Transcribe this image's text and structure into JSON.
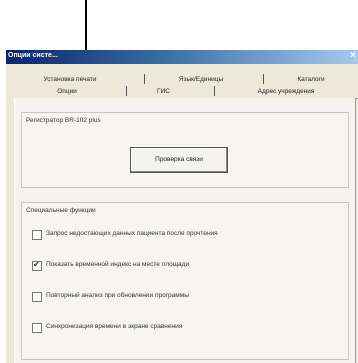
{
  "window": {
    "title": "Опции систе...",
    "close_icon": "close-icon"
  },
  "tabs_back": [
    "Установка печати",
    "Язык/Единицы",
    "Каталоги"
  ],
  "tabs_front": [
    "Опции",
    "ГИС",
    "Адрес учреждения"
  ],
  "registrator": {
    "label": "Регистратор BR-102 plus",
    "test_button": "Проверка связи"
  },
  "special": {
    "title": "Специальные функции",
    "options": [
      {
        "label": "Запрос недостающих данных пациента после прочтения",
        "checked": false
      },
      {
        "label": "Показать временной индекс на месте площади",
        "checked": true
      },
      {
        "label": "Повторный анализ при обновлении программы",
        "checked": false
      },
      {
        "label": "Синхронизация времени в экране сравнения",
        "checked": false
      }
    ]
  }
}
